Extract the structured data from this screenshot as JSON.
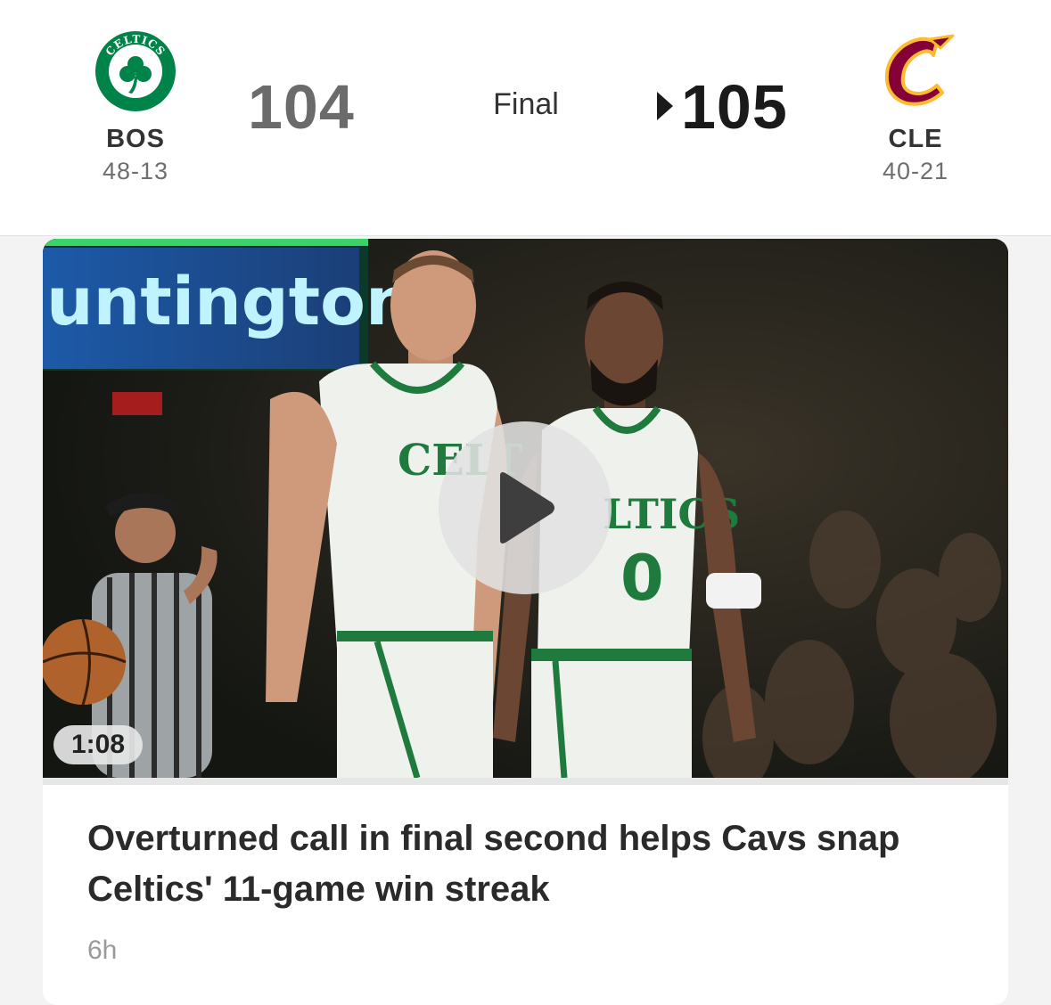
{
  "game": {
    "status": "Final",
    "home": {
      "abbr": "BOS",
      "record": "48-13",
      "score": "104",
      "logo_icon": "celtics-logo-icon",
      "logo_text": "CELTICS",
      "color": "#008348"
    },
    "away": {
      "abbr": "CLE",
      "record": "40-21",
      "score": "105",
      "logo_icon": "cavaliers-logo-icon",
      "color": "#860038",
      "accent": "#FDBB30"
    },
    "winner": "away"
  },
  "story": {
    "video_duration": "1:08",
    "arena_sign_text": "untington",
    "headline": "Overturned call in final second helps Cavs snap Celtics' 11-game win streak",
    "time_ago": "6h"
  }
}
